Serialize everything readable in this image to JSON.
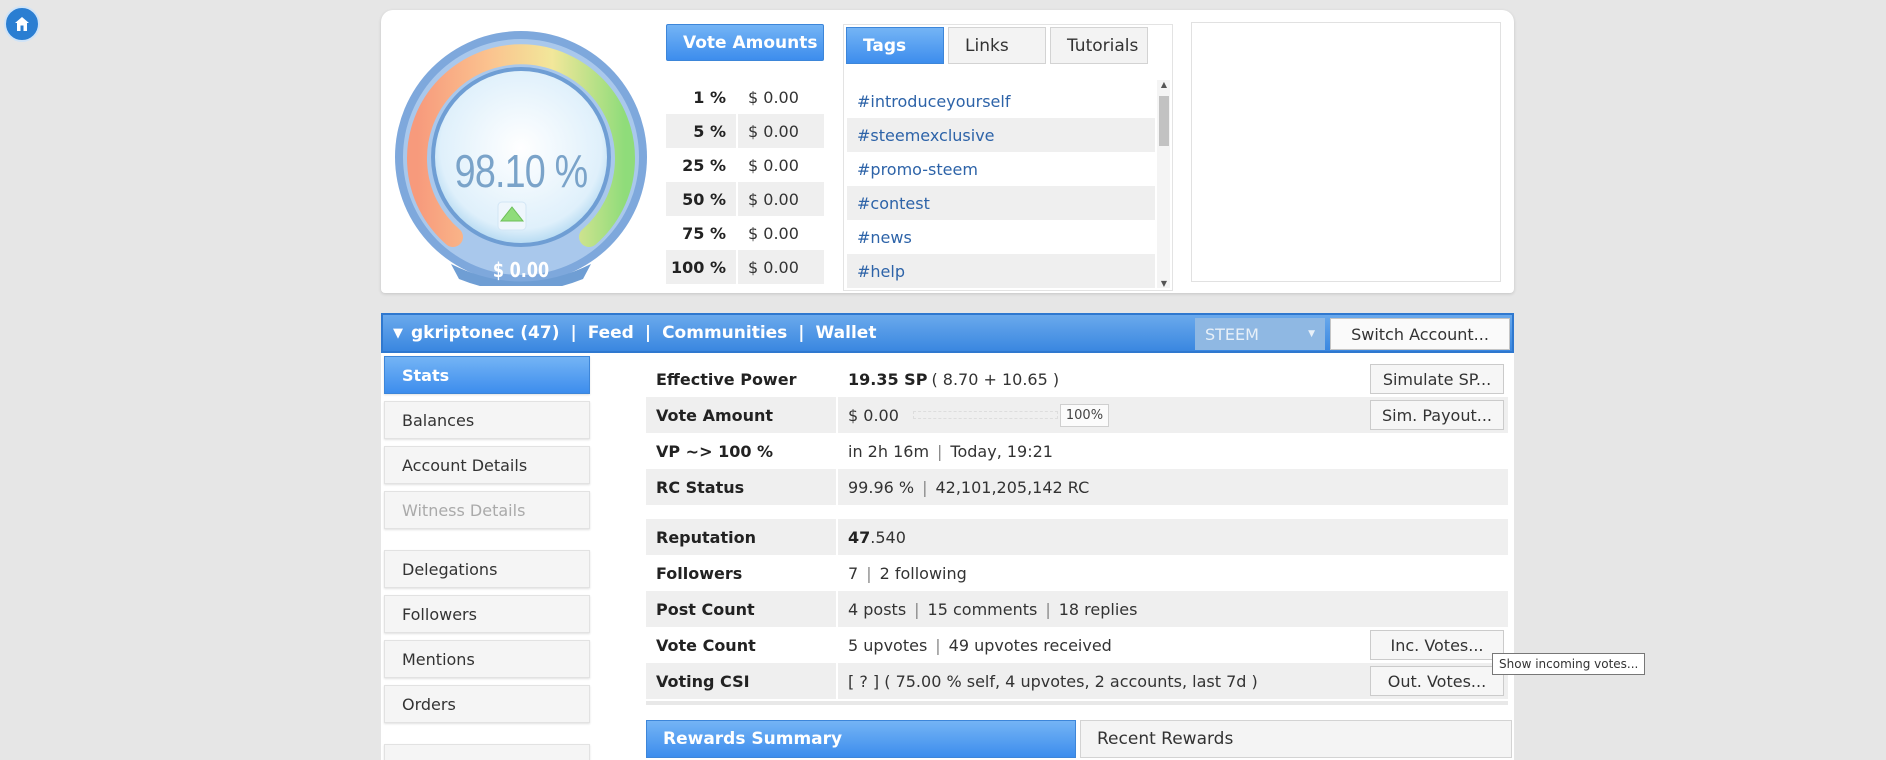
{
  "gauge": {
    "percent": "98.10 %",
    "amount": "$ 0.00",
    "level": 0.981
  },
  "vote_amounts": {
    "title": "Vote Amounts",
    "rows": [
      {
        "pct": "1 %",
        "val": "$ 0.00"
      },
      {
        "pct": "5 %",
        "val": "$ 0.00"
      },
      {
        "pct": "25 %",
        "val": "$ 0.00"
      },
      {
        "pct": "50 %",
        "val": "$ 0.00"
      },
      {
        "pct": "75 %",
        "val": "$ 0.00"
      },
      {
        "pct": "100 %",
        "val": "$ 0.00"
      }
    ]
  },
  "tags_panel": {
    "tabs": [
      "Tags",
      "Links",
      "Tutorials"
    ],
    "tags": [
      "#introduceyourself",
      "#steemexclusive",
      "#promo-steem",
      "#contest",
      "#news",
      "#help"
    ]
  },
  "nav": {
    "account": "gkriptonec (47)",
    "sep": "|",
    "feed": "Feed",
    "communities": "Communities",
    "wallet": "Wallet",
    "currency": "STEEM",
    "switch_label": "Switch Account..."
  },
  "side_menu": {
    "stats": "Stats",
    "balances": "Balances",
    "account_details": "Account Details",
    "witness_details": "Witness Details",
    "delegations": "Delegations",
    "followers": "Followers",
    "mentions": "Mentions",
    "orders": "Orders"
  },
  "stats": {
    "effective_power": {
      "label": "Effective Power",
      "main": "19.35 SP",
      "detail": "( 8.70 + 10.65 )",
      "button": "Simulate SP..."
    },
    "vote_amount": {
      "label": "Vote Amount",
      "value": "$ 0.00",
      "slider": "100%",
      "button": "Sim. Payout..."
    },
    "vp": {
      "label": "VP ~> 100 %",
      "time": "in 2h 16m",
      "when": "Today, 19:21"
    },
    "rc": {
      "label": "RC Status",
      "pct": "99.96 %",
      "rc": "42,101,205,142 RC"
    },
    "reputation": {
      "label": "Reputation",
      "major": "47",
      "minor": ".540"
    },
    "followers": {
      "label": "Followers",
      "count": "7",
      "following": "2 following"
    },
    "post_count": {
      "label": "Post Count",
      "posts": "4 posts",
      "comments": "15 comments",
      "replies": "18 replies"
    },
    "vote_count": {
      "label": "Vote Count",
      "upvotes": "5 upvotes",
      "received": "49 upvotes received",
      "button": "Inc. Votes..."
    },
    "csi": {
      "label": "Voting CSI",
      "value": "[ ? ] ( 75.00 % self, 4 upvotes, 2 accounts, last 7d )",
      "button": "Out. Votes..."
    }
  },
  "tooltip": "Show incoming votes...",
  "bottom_tabs": {
    "rewards_summary": "Rewards Summary",
    "recent_rewards": "Recent Rewards"
  }
}
